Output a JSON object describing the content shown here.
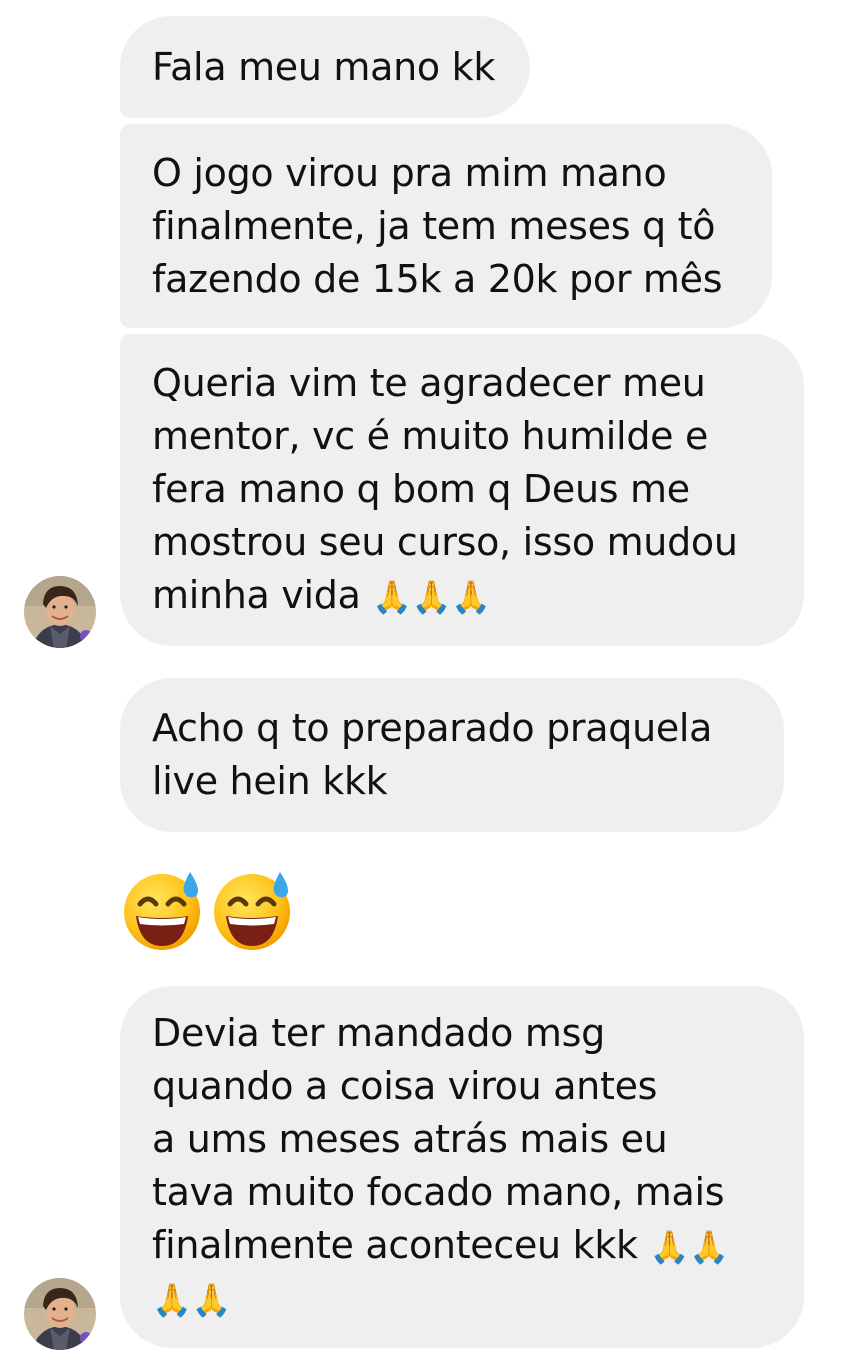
{
  "messages": [
    {
      "lines": [
        "Fala meu mano kk"
      ]
    },
    {
      "lines": [
        "O jogo virou pra mim mano",
        "finalmente, ja tem meses q tô",
        "fazendo de 15k a 20k por mês"
      ]
    },
    {
      "lines": [
        "Queria vim te agradecer meu",
        "mentor, vc é muito humilde e",
        "fera mano q bom q Deus me",
        "mostrou seu curso, isso mudou",
        "minha vida"
      ],
      "trailing_emoji": "🙏🙏🙏"
    },
    {
      "lines": [
        "Acho q to preparado praquela",
        "live hein kkk"
      ]
    },
    {
      "emoji_only": "😅😅"
    },
    {
      "lines": [
        "Devia ter mandado msg",
        "quando a coisa virou antes",
        "a ums meses atrás mais eu",
        "tava muito focado mano, mais",
        "finalmente aconteceu kkk"
      ],
      "trailing_emoji": "🙏🙏",
      "extra_emoji_line": "🙏🙏"
    }
  ],
  "icons": {
    "avatar": "sender-avatar",
    "emoji_sweat_smile": "grinning-face-with-sweat-icon",
    "emoji_pray": "folded-hands-icon"
  },
  "colors": {
    "bubble_bg": "#efefef",
    "text": "#111111",
    "background": "#ffffff"
  }
}
